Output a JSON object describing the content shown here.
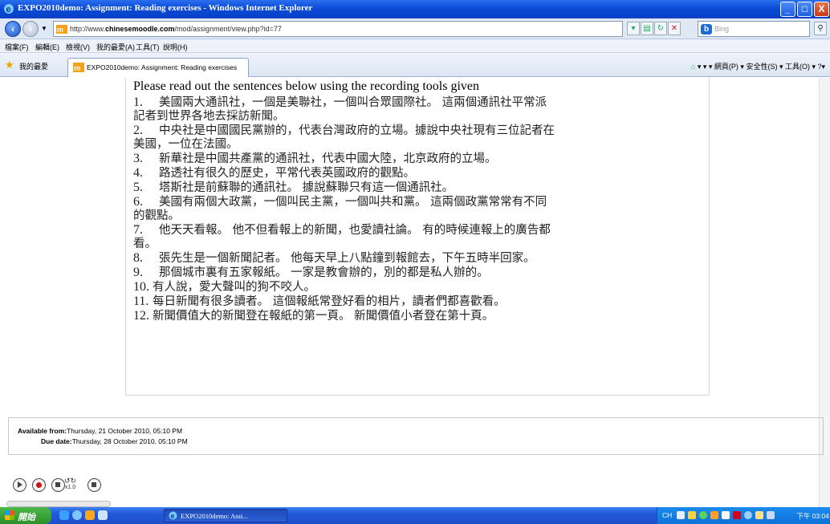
{
  "window": {
    "title": "EXPO2010demo: Assignment: Reading exercises - Windows Internet Explorer",
    "minimize": "_",
    "maximize": "□",
    "close": "X"
  },
  "address_bar": {
    "url_prefix": "http://www.",
    "url_domain": "chinesemoodle.com",
    "url_path": "/mod/assignment/view.php?id=77",
    "search_placeholder": "Bing"
  },
  "menu": {
    "items": [
      "檔案(F)",
      "編輯(E)",
      "檢視(V)",
      "我的最愛(A)",
      "工具(T)",
      "說明(H)"
    ]
  },
  "favorites_bar": {
    "favorites_label": "我的最愛",
    "tab_label": "EXPO2010demo: Assignment: Reading exercises",
    "command_bar": "▾  ▾  ▾  網頁(P) ▾  安全性(S) ▾  工具(O) ▾  ?▾"
  },
  "assignment": {
    "heading": "Please read out the sentences below using the recording tools given",
    "sentences": [
      {
        "num": "1.",
        "lines": [
          "美國兩大通訊社，一個是美聯社，一個叫合眾國際社。 這兩個通訊社平常派",
          "記者到世界各地去採訪新聞。"
        ]
      },
      {
        "num": "2.",
        "lines": [
          "中央社是中國國民黨辦的，代表台灣政府的立場。據說中央社現有三位記者在",
          "美國，一位在法國。"
        ]
      },
      {
        "num": "3.",
        "lines": [
          "新華社是中國共產黨的通訊社，代表中國大陸，北京政府的立場。"
        ]
      },
      {
        "num": "4.",
        "lines": [
          "路透社有很久的歷史，平常代表英國政府的觀點。"
        ]
      },
      {
        "num": "5.",
        "lines": [
          "塔斯社是前蘇聯的通訊社。 據說蘇聯只有這一個通訊社。"
        ]
      },
      {
        "num": "6.",
        "lines": [
          "美國有兩個大政黨，一個叫民主黨，一個叫共和黨。 這兩個政黨常常有不同",
          "的觀點。"
        ]
      },
      {
        "num": "7.",
        "lines": [
          "他天天看報。 他不但看報上的新聞，也愛讀社論。 有的時候連報上的廣告都",
          "看。"
        ]
      },
      {
        "num": "8.",
        "lines": [
          "張先生是一個新聞記者。 他每天早上八點鐘到報館去，下午五時半回家。"
        ]
      },
      {
        "num": "9.",
        "lines": [
          "那個城市裏有五家報紙。 一家是教會辦的，別的都是私人辦的。"
        ]
      },
      {
        "num": "10.",
        "lines": [
          "有人說，愛大聲叫的狗不咬人。"
        ]
      },
      {
        "num": "11.",
        "lines": [
          "每日新聞有很多讀者。 這個報紙常登好看的相片，讀者們都喜歡看。"
        ]
      },
      {
        "num": "12.",
        "lines": [
          "新聞價值大的新聞登在報紙的第一頁。 新聞價值小者登在第十頁。"
        ]
      }
    ],
    "available_label": "Available from:",
    "available_value": "Thursday, 21 October 2010, 05:10 PM",
    "due_label": "Due date:",
    "due_value": "Thursday, 28 October 2010, 05:10 PM"
  },
  "player": {
    "speed_label": "x1.0"
  },
  "taskbar": {
    "start_label": "開始",
    "window_label": "EXPO2010demo: Assi...",
    "tray_lang": "CH",
    "clock": "下午 03:04"
  }
}
